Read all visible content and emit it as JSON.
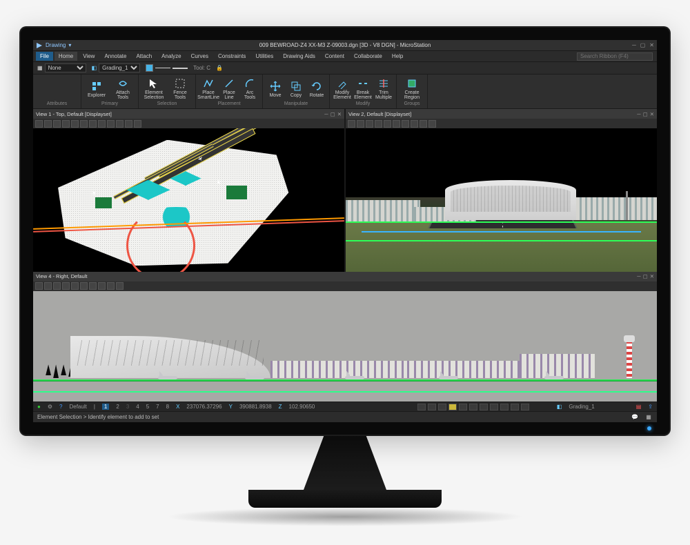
{
  "app": {
    "title": "009 BEWROAD-Z4 XX-M3 Z-09003.dgn [3D - V8 DGN] - MicroStation",
    "workspace": "Drawing",
    "search_placeholder": "Search Ribbon (F4)"
  },
  "menus": {
    "file": "File",
    "tabs": [
      "Home",
      "View",
      "Annotate",
      "Attach",
      "Analyze",
      "Curves",
      "Constraints",
      "Utilities",
      "Drawing Aids",
      "Content",
      "Collaborate",
      "Help"
    ],
    "active": "Home"
  },
  "quickbar": {
    "level_label": "None",
    "template_label": "Grading_1",
    "tool_label": "Tool: C",
    "lock_icon": "lock-icon",
    "color_icon": "color-icon"
  },
  "ribbon": {
    "groups": [
      {
        "name": "Attributes",
        "label": "Attributes",
        "buttons": []
      },
      {
        "name": "Primary",
        "label": "Primary",
        "buttons": [
          {
            "name": "explorer-button",
            "label": "Explorer",
            "icon": "tree-icon"
          },
          {
            "name": "attach-tools-button",
            "label": "Attach Tools",
            "icon": "attach-icon"
          }
        ]
      },
      {
        "name": "Selection",
        "label": "Selection",
        "buttons": [
          {
            "name": "element-selection-button",
            "label": "Element Selection",
            "icon": "cursor-icon"
          },
          {
            "name": "fence-tools-button",
            "label": "Fence Tools",
            "icon": "fence-icon"
          }
        ]
      },
      {
        "name": "Placement",
        "label": "Placement",
        "buttons": [
          {
            "name": "place-smartline-button",
            "label": "Place SmartLine",
            "icon": "polyline-icon"
          },
          {
            "name": "place-line-button",
            "label": "Place Line",
            "icon": "line-icon"
          },
          {
            "name": "arc-tools-button",
            "label": "Arc Tools",
            "icon": "arc-icon"
          }
        ]
      },
      {
        "name": "Manipulate",
        "label": "Manipulate",
        "buttons": [
          {
            "name": "move-button",
            "label": "Move",
            "icon": "move-icon"
          },
          {
            "name": "copy-button",
            "label": "Copy",
            "icon": "copy-icon"
          },
          {
            "name": "rotate-button",
            "label": "Rotate",
            "icon": "rotate-icon"
          }
        ]
      },
      {
        "name": "Modify",
        "label": "Modify",
        "buttons": [
          {
            "name": "modify-element-button",
            "label": "Modify Element",
            "icon": "modify-icon"
          },
          {
            "name": "break-element-button",
            "label": "Break Element",
            "icon": "break-icon"
          },
          {
            "name": "trim-multiple-button",
            "label": "Trim Multiple",
            "icon": "trim-icon"
          }
        ]
      },
      {
        "name": "Groups",
        "label": "Groups",
        "buttons": [
          {
            "name": "create-region-button",
            "label": "Create Region",
            "icon": "region-icon"
          }
        ]
      }
    ]
  },
  "views": {
    "v1": {
      "title": "View 1 - Top, Default [Displayset]"
    },
    "v2": {
      "title": "View 2, Default [Displayset]"
    },
    "v4": {
      "title": "View 4 - Right, Default"
    }
  },
  "status": {
    "snap": "Default",
    "coord_s": "5",
    "coord_l": "7",
    "coord_n": "8",
    "x_label": "X",
    "x": "237076.37296",
    "y_label": "Y",
    "y": "390881.8938",
    "z_label": "Z",
    "z": "102.90650",
    "active_level": "Grading_1",
    "prompt": "Element Selection > Identify element to add to set"
  },
  "colors": {
    "accent": "#3aa8ff",
    "runway_outline": "#f5e04a",
    "road": "#e54444",
    "terminal_plan": "#1cc7c7",
    "perimeter": "#2dff57"
  }
}
